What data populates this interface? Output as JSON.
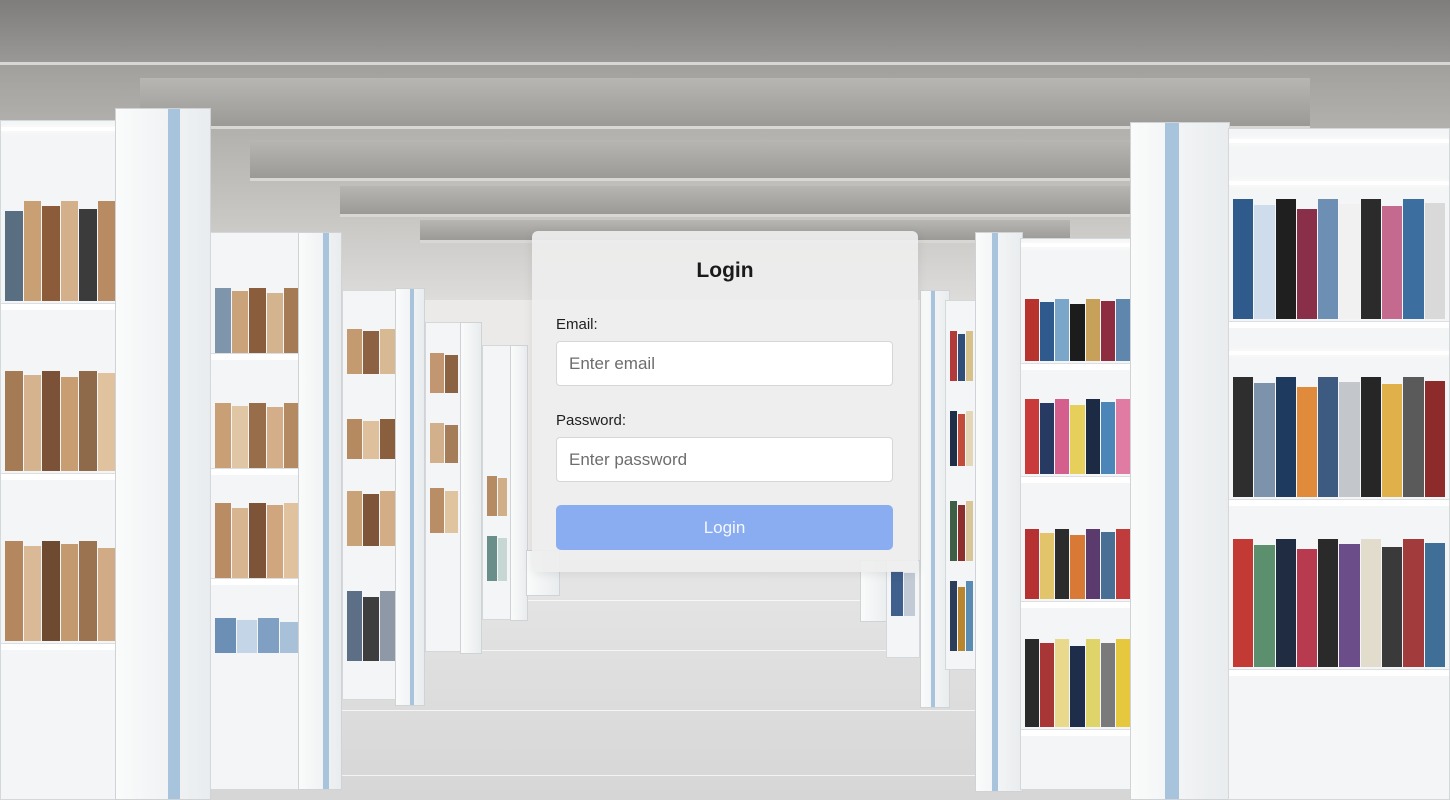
{
  "login": {
    "title": "Login",
    "email_label": "Email:",
    "email_placeholder": "Enter email",
    "email_value": "",
    "password_label": "Password:",
    "password_placeholder": "Enter password",
    "password_value": "",
    "submit_label": "Login"
  },
  "colors": {
    "button_bg": "#89adf0",
    "card_bg": "#eeeeee",
    "shelf_stripe": "#a8c4dc"
  },
  "background": {
    "icon": "library-bookshelves-photo"
  }
}
